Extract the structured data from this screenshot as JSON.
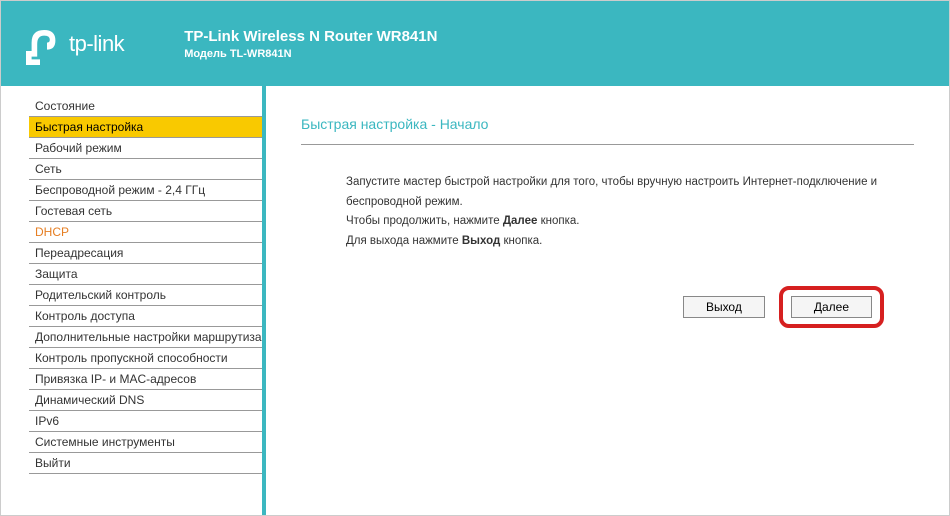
{
  "header": {
    "logo_text": "tp-link",
    "title": "TP-Link Wireless N Router WR841N",
    "subtitle": "Модель TL-WR841N"
  },
  "sidebar": {
    "items": [
      {
        "label": "Состояние"
      },
      {
        "label": "Быстрая настройка"
      },
      {
        "label": "Рабочий режим"
      },
      {
        "label": "Сеть"
      },
      {
        "label": "Беспроводной режим - 2,4 ГГц"
      },
      {
        "label": "Гостевая сеть"
      },
      {
        "label": "DHCP"
      },
      {
        "label": "Переадресация"
      },
      {
        "label": "Защита"
      },
      {
        "label": "Родительский контроль"
      },
      {
        "label": "Контроль доступа"
      },
      {
        "label": "Дополнительные настройки маршрутизации"
      },
      {
        "label": "Контроль пропускной способности"
      },
      {
        "label": "Привязка IP- и MAC-адресов"
      },
      {
        "label": "Динамический DNS"
      },
      {
        "label": "IPv6"
      },
      {
        "label": "Системные инструменты"
      },
      {
        "label": "Выйти"
      }
    ]
  },
  "main": {
    "page_title": "Быстрая настройка - Начало",
    "line1": "Запустите мастер быстрой настройки для того, чтобы вручную настроить Интернет-подключение и беспроводной режим.",
    "line2_pre": "Чтобы продолжить, нажмите ",
    "line2_bold": "Далее",
    "line2_post": " кнопка.",
    "line3_pre": "Для выхода нажмите ",
    "line3_bold": "Выход",
    "line3_post": " кнопка.",
    "exit_button": "Выход",
    "next_button": "Далее"
  }
}
